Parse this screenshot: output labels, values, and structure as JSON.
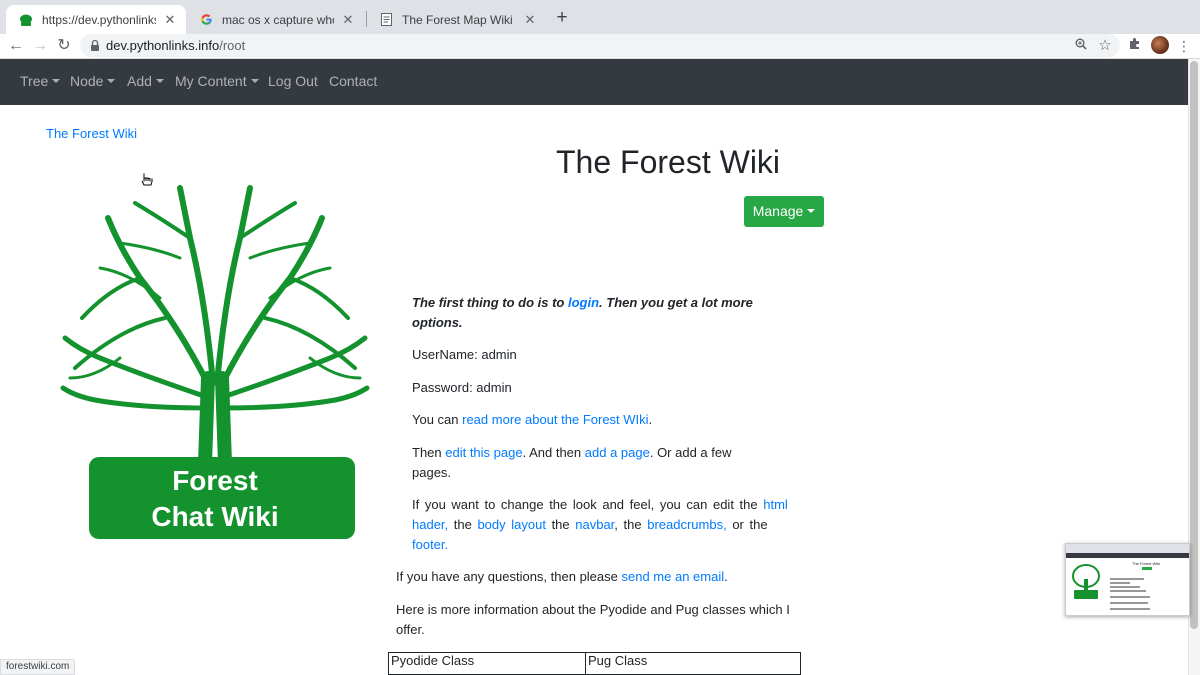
{
  "browser": {
    "tabs": [
      {
        "title": "https://dev.pythonlinks.info/root",
        "active": true,
        "favicon": "forest-tree-icon"
      },
      {
        "title": "mac os x capture whole screen",
        "active": false,
        "favicon": "google-g-icon"
      },
      {
        "title": "The Forest Map Wiki -> Forest Wiki",
        "active": false,
        "favicon": "document-icon"
      }
    ],
    "url_host": "dev.pythonlinks.info",
    "url_path": "/root",
    "status_url": "forestwiki.com"
  },
  "navbar": {
    "items": [
      {
        "label": "Tree",
        "dropdown": true
      },
      {
        "label": "Node",
        "dropdown": true
      },
      {
        "label": "Add",
        "dropdown": true
      },
      {
        "label": "My Content",
        "dropdown": true
      },
      {
        "label": "Log Out",
        "dropdown": false
      },
      {
        "label": "Contact",
        "dropdown": false
      }
    ]
  },
  "breadcrumb": "The Forest Wiki",
  "logo": {
    "line1": "Forest",
    "line2": "Chat Wiki",
    "color": "#13922e"
  },
  "page_title": "The Forest Wiki",
  "manage_label": "Manage",
  "content": {
    "intro_a": "The first thing to do is to ",
    "intro_link": "login",
    "intro_b": ".  Then you get a lot more options.",
    "username": "UserName: admin",
    "password": "Password: admin",
    "readmore_a": "You can ",
    "readmore_link": "read more about the Forest WIki",
    "readmore_b": ".",
    "then_a": "Then ",
    "edit_link": "edit this page",
    "then_b": ".  And then ",
    "add_link": "add a page",
    "then_c": ".  Or add a few pages.",
    "look_a": "If you want to change the look and feel,  you can edit  the  ",
    "html_link": "html hader,",
    "look_b": "  the  ",
    "body_link": "body layout",
    "look_c": "  the  ",
    "navbar_link": "navbar",
    "look_d": ",  the  ",
    "breadcrumbs_link": "breadcrumbs,",
    "look_e": "  or the  ",
    "footer_link": "footer.",
    "questions_a": "If you have any questions, then please ",
    "email_link": "send me an email",
    "questions_b": ".",
    "classes_info": "Here is more information about the Pyodide and Pug classes which I offer."
  },
  "table": {
    "headers": [
      "Pyodide Class",
      "Pug Class"
    ]
  },
  "colors": {
    "navbar": "#343a40",
    "link": "#007bff",
    "manage": "#28a745",
    "logo_green": "#13922e"
  }
}
